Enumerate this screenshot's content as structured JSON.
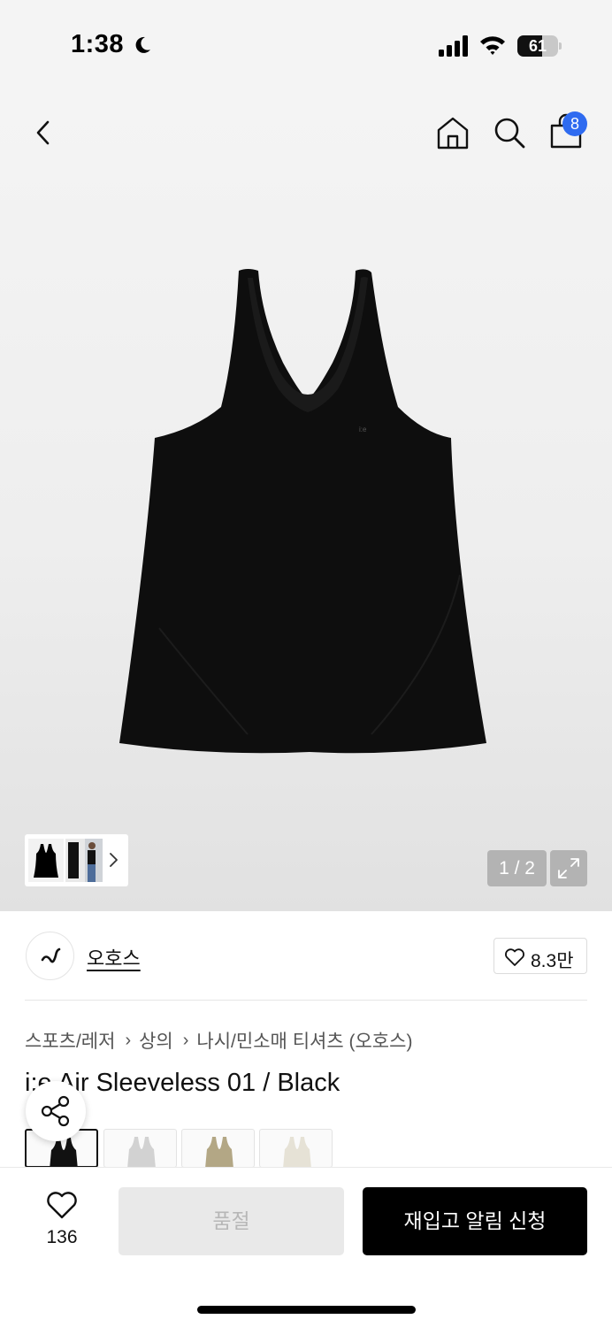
{
  "status_bar": {
    "time": "1:38",
    "battery_level": "61",
    "battery_fraction": 0.61
  },
  "nav": {
    "cart_count": "8",
    "icons": [
      "back-icon",
      "home-icon",
      "search-icon",
      "shopping-bag-icon"
    ]
  },
  "gallery": {
    "page_counter": "1 / 2",
    "thumbnail_icons": [
      "tank-top-thumbnail",
      "side-view-thumbnail",
      "model-thumbnail"
    ]
  },
  "brand": {
    "name": "오호스",
    "like_count": "8.3만"
  },
  "breadcrumb": [
    "스포츠/레저",
    "상의",
    "나시/민소매 티셔츠 (오호스)"
  ],
  "product": {
    "title": "i:e Air Sleeveless 01 / Black",
    "color_swatches": [
      {
        "color": "#111111",
        "selected": true
      },
      {
        "color": "#d2d2d2",
        "selected": false
      },
      {
        "color": "#b3a785",
        "selected": false
      },
      {
        "color": "#e6e2d6",
        "selected": false
      }
    ]
  },
  "actions": {
    "wish_count": "136",
    "soldout_label": "품절",
    "restock_label": "재입고 알림 신청"
  },
  "colors": {
    "accent_badge": "#2f6bf0",
    "primary_button": "#000000",
    "disabled_button": "#e9e9e9"
  }
}
